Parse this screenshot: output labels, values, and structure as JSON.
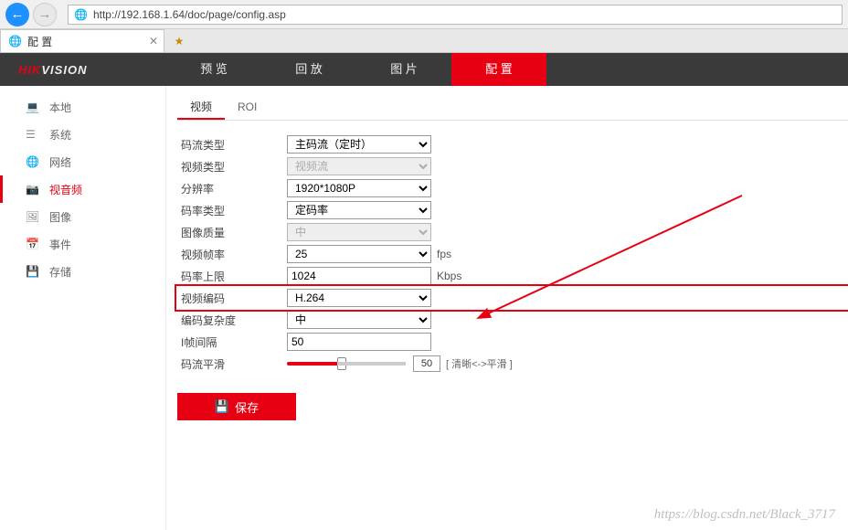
{
  "browser": {
    "url": "http://192.168.1.64/doc/page/config.asp"
  },
  "tab": {
    "title": "配 置"
  },
  "logo": {
    "red": "HIK",
    "rest": "VISION"
  },
  "topnav": [
    {
      "label": "预 览"
    },
    {
      "label": "回 放"
    },
    {
      "label": "图 片"
    },
    {
      "label": "配 置",
      "active": true
    }
  ],
  "sidebar": [
    {
      "label": "本地",
      "icon": "monitor"
    },
    {
      "label": "系统",
      "icon": "list"
    },
    {
      "label": "网络",
      "icon": "globe"
    },
    {
      "label": "视音频",
      "icon": "camera",
      "active": true
    },
    {
      "label": "图像",
      "icon": "sliders"
    },
    {
      "label": "事件",
      "icon": "event"
    },
    {
      "label": "存储",
      "icon": "storage"
    }
  ],
  "subtabs": [
    {
      "label": "视频",
      "active": true
    },
    {
      "label": "ROI"
    }
  ],
  "form": {
    "stream_type": {
      "label": "码流类型",
      "value": "主码流（定时）"
    },
    "video_type": {
      "label": "视频类型",
      "value": "视频流",
      "disabled": true
    },
    "resolution": {
      "label": "分辨率",
      "value": "1920*1080P"
    },
    "bitrate_type": {
      "label": "码率类型",
      "value": "定码率"
    },
    "image_quality": {
      "label": "图像质量",
      "value": "中",
      "disabled": true
    },
    "frame_rate": {
      "label": "视频帧率",
      "value": "25",
      "unit": "fps"
    },
    "max_bitrate": {
      "label": "码率上限",
      "value": "1024",
      "unit": "Kbps"
    },
    "video_encoding": {
      "label": "视频编码",
      "value": "H.264",
      "highlight": true
    },
    "complexity": {
      "label": "编码复杂度",
      "value": "中"
    },
    "iframe": {
      "label": "I帧间隔",
      "value": "50"
    },
    "smoothing": {
      "label": "码流平滑",
      "value": "50",
      "hint": "[ 清晰<->平滑 ]"
    }
  },
  "save": {
    "label": "保存"
  },
  "watermark": "https://blog.csdn.net/Black_3717"
}
